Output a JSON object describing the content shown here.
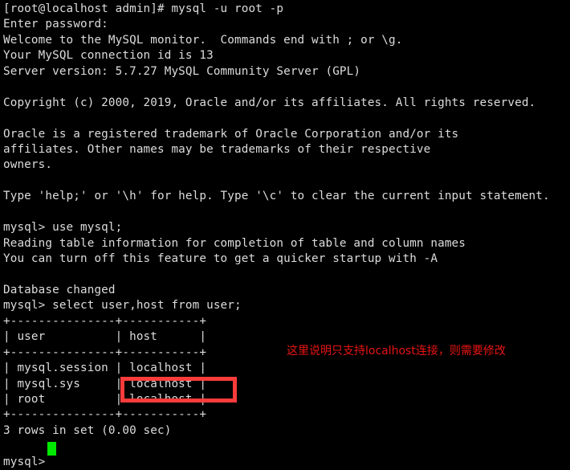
{
  "terminal": {
    "background_color": "#000000",
    "text_color": "#dcdcdc",
    "cursor_color": "#00e800",
    "annotation_color": "#e81414",
    "highlight_box_color": "#fa3c3c",
    "lines": [
      "[root@localhost admin]# mysql -u root -p",
      "Enter password:",
      "Welcome to the MySQL monitor.  Commands end with ; or \\g.",
      "Your MySQL connection id is 13",
      "Server version: 5.7.27 MySQL Community Server (GPL)",
      "",
      "Copyright (c) 2000, 2019, Oracle and/or its affiliates. All rights reserved.",
      "",
      "Oracle is a registered trademark of Oracle Corporation and/or its",
      "affiliates. Other names may be trademarks of their respective",
      "owners.",
      "",
      "Type 'help;' or '\\h' for help. Type '\\c' to clear the current input statement.",
      "",
      "mysql> use mysql;",
      "Reading table information for completion of table and column names",
      "You can turn off this feature to get a quicker startup with -A",
      "",
      "Database changed",
      "mysql> select user,host from user;",
      "+---------------+-----------+",
      "| user          | host      |",
      "+---------------+-----------+",
      "| mysql.session | localhost |",
      "| mysql.sys     | localhost |",
      "| root          | localhost |",
      "+---------------+-----------+",
      "3 rows in set (0.00 sec)",
      "",
      "mysql> "
    ]
  },
  "command_prompt": {
    "shell_prompt": "[root@localhost admin]#",
    "shell_command": "mysql -u root -p",
    "password_prompt": "Enter password:",
    "mysql_prompt": "mysql>",
    "commands": [
      "use mysql;",
      "select user,host from user;"
    ]
  },
  "mysql_banner": {
    "welcome": "Welcome to the MySQL monitor.  Commands end with ; or \\g.",
    "connection_id": "Your MySQL connection id is 13",
    "server_version": "Server version: 5.7.27 MySQL Community Server (GPL)",
    "copyright": "Copyright (c) 2000, 2019, Oracle and/or its affiliates. All rights reserved.",
    "trademark_line_1": "Oracle is a registered trademark of Oracle Corporation and/or its",
    "trademark_line_2": "affiliates. Other names may be trademarks of their respective",
    "trademark_line_3": "owners.",
    "help_hint": "Type 'help;' or '\\h' for help. Type '\\c' to clear the current input statement."
  },
  "use_database_output": {
    "reading_line_1": "Reading table information for completion of table and column names",
    "reading_line_2": "You can turn off this feature to get a quicker startup with -A",
    "status": "Database changed"
  },
  "result_table": {
    "top_border": "+---------------+-----------+",
    "header_row": "| user          | host      |",
    "header_separator": "+---------------+-----------+",
    "bottom_border": "+---------------+-----------+",
    "columns": [
      "user",
      "host"
    ],
    "rows": [
      {
        "raw": "| mysql.session | localhost |",
        "user": "mysql.session",
        "host": "localhost"
      },
      {
        "raw": "| mysql.sys     | localhost |",
        "user": "mysql.sys",
        "host": "localhost"
      },
      {
        "raw": "| root          | localhost |",
        "user": "root",
        "host": "localhost"
      }
    ],
    "footer": "3 rows in set (0.00 sec)",
    "row_count": 3,
    "elapsed": "0.00 sec"
  },
  "annotation": {
    "text": "这里说明只支持localhost连接，则需要修改",
    "highlighted_cell_value": "localhost"
  }
}
